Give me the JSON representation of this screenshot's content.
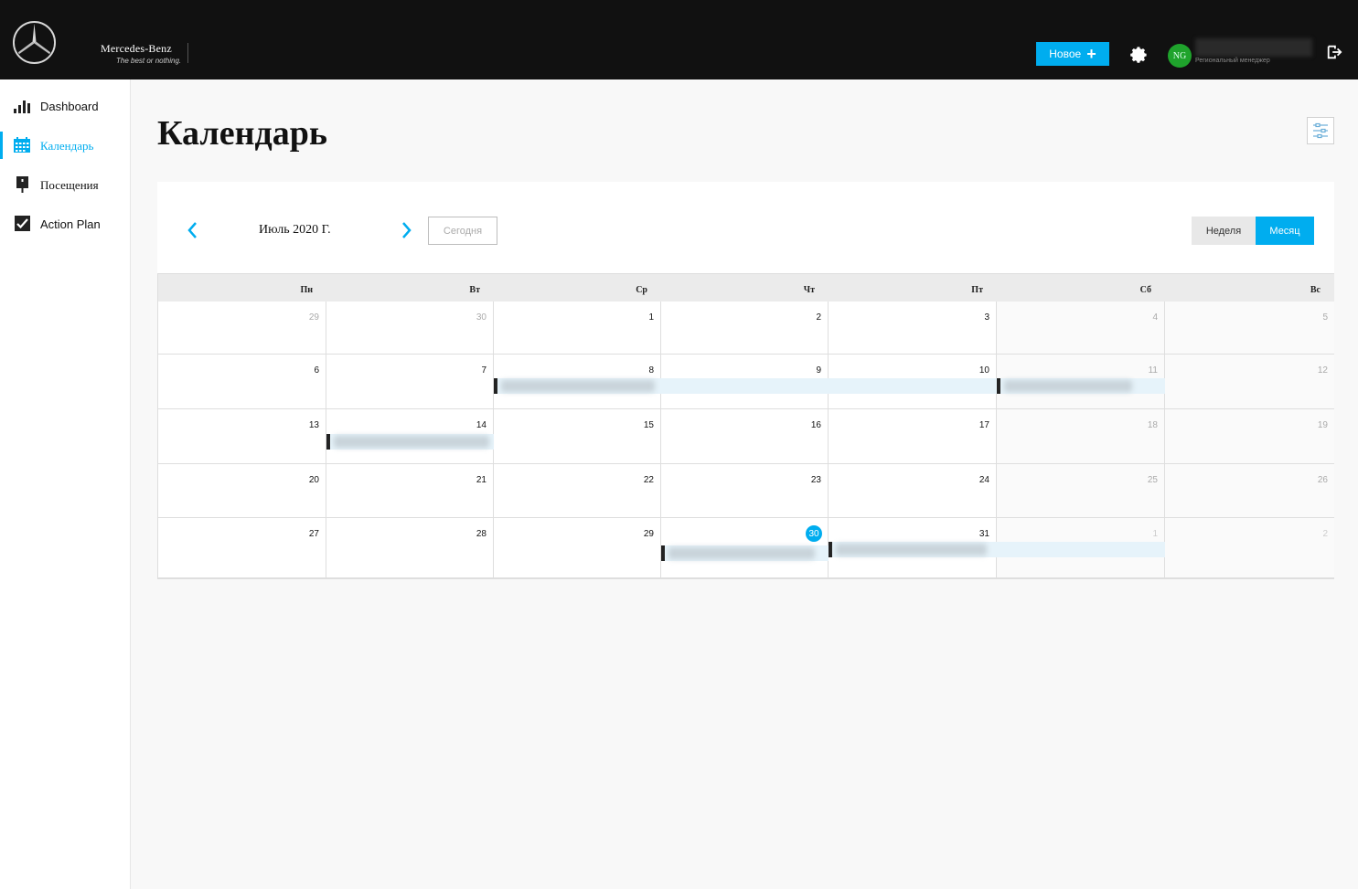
{
  "header": {
    "brand_name": "Mercedes-Benz",
    "brand_tagline": "The best or nothing.",
    "new_button_label": "Новое",
    "new_button_icon": "plus-icon",
    "avatar_initials": "NG",
    "user_role": "Региональный менеджер",
    "accent_color": "#00adef"
  },
  "sidebar": {
    "items": [
      {
        "label": "Dashboard",
        "icon": "bar-chart-icon"
      },
      {
        "label": "Календарь",
        "icon": "calendar-icon",
        "active": true
      },
      {
        "label": "Посещения",
        "icon": "location-pin-icon"
      },
      {
        "label": "Action Plan",
        "icon": "checkbox-icon"
      }
    ]
  },
  "page": {
    "title": "Календарь"
  },
  "calendar": {
    "month_label": "Июль 2020 Г.",
    "today_label": "Сегодня",
    "week_label": "Неделя",
    "month_view_label": "Месяц",
    "weekdays": [
      "Пн",
      "Вт",
      "Ср",
      "Чт",
      "Пт",
      "Сб",
      "Вс"
    ],
    "weeks": [
      [
        "29",
        "30",
        "1",
        "2",
        "3",
        "4",
        "5"
      ],
      [
        "6",
        "7",
        "8",
        "9",
        "10",
        "11",
        "12"
      ],
      [
        "13",
        "14",
        "15",
        "16",
        "17",
        "18",
        "19"
      ],
      [
        "20",
        "21",
        "22",
        "23",
        "24",
        "25",
        "26"
      ],
      [
        "27",
        "28",
        "29",
        "30",
        "31",
        "1",
        "2"
      ]
    ],
    "today_date": "30"
  }
}
